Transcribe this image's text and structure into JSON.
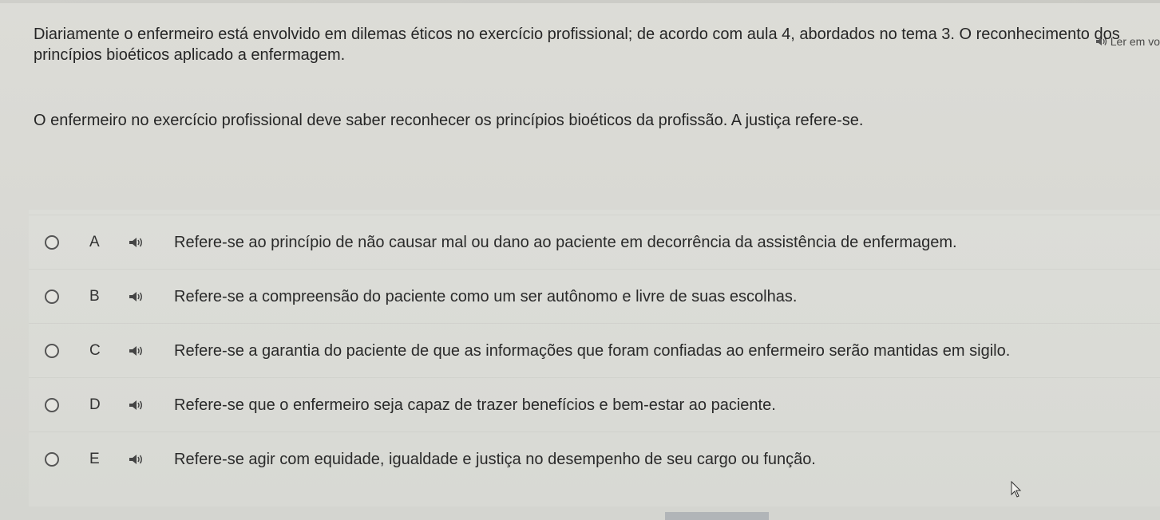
{
  "read_aloud": {
    "label": "Ler em vo",
    "icon": "speaker-icon"
  },
  "question": {
    "text": "Diariamente o enfermeiro está envolvido em dilemas éticos no exercício profissional; de acordo com aula 4, abordados no tema 3. O reconhecimento dos princípios bioéticos aplicado a enfermagem.",
    "statement": "O enfermeiro no exercício profissional deve saber reconhecer os princípios bioéticos da profissão. A justiça refere-se."
  },
  "options": [
    {
      "letter": "A",
      "text": "Refere-se ao princípio de não causar mal ou dano ao paciente em decorrência da assistência de enfermagem."
    },
    {
      "letter": "B",
      "text": "Refere-se a compreensão do paciente como um ser autônomo e livre de suas escolhas."
    },
    {
      "letter": "C",
      "text": "Refere-se a garantia do paciente de que as informações que foram confiadas ao enfermeiro serão mantidas em sigilo."
    },
    {
      "letter": "D",
      "text": "Refere-se que o enfermeiro seja capaz de trazer benefícios e bem-estar ao paciente."
    },
    {
      "letter": "E",
      "text": "Refere-se agir com equidade, igualdade e justiça no desempenho de seu cargo ou função."
    }
  ]
}
